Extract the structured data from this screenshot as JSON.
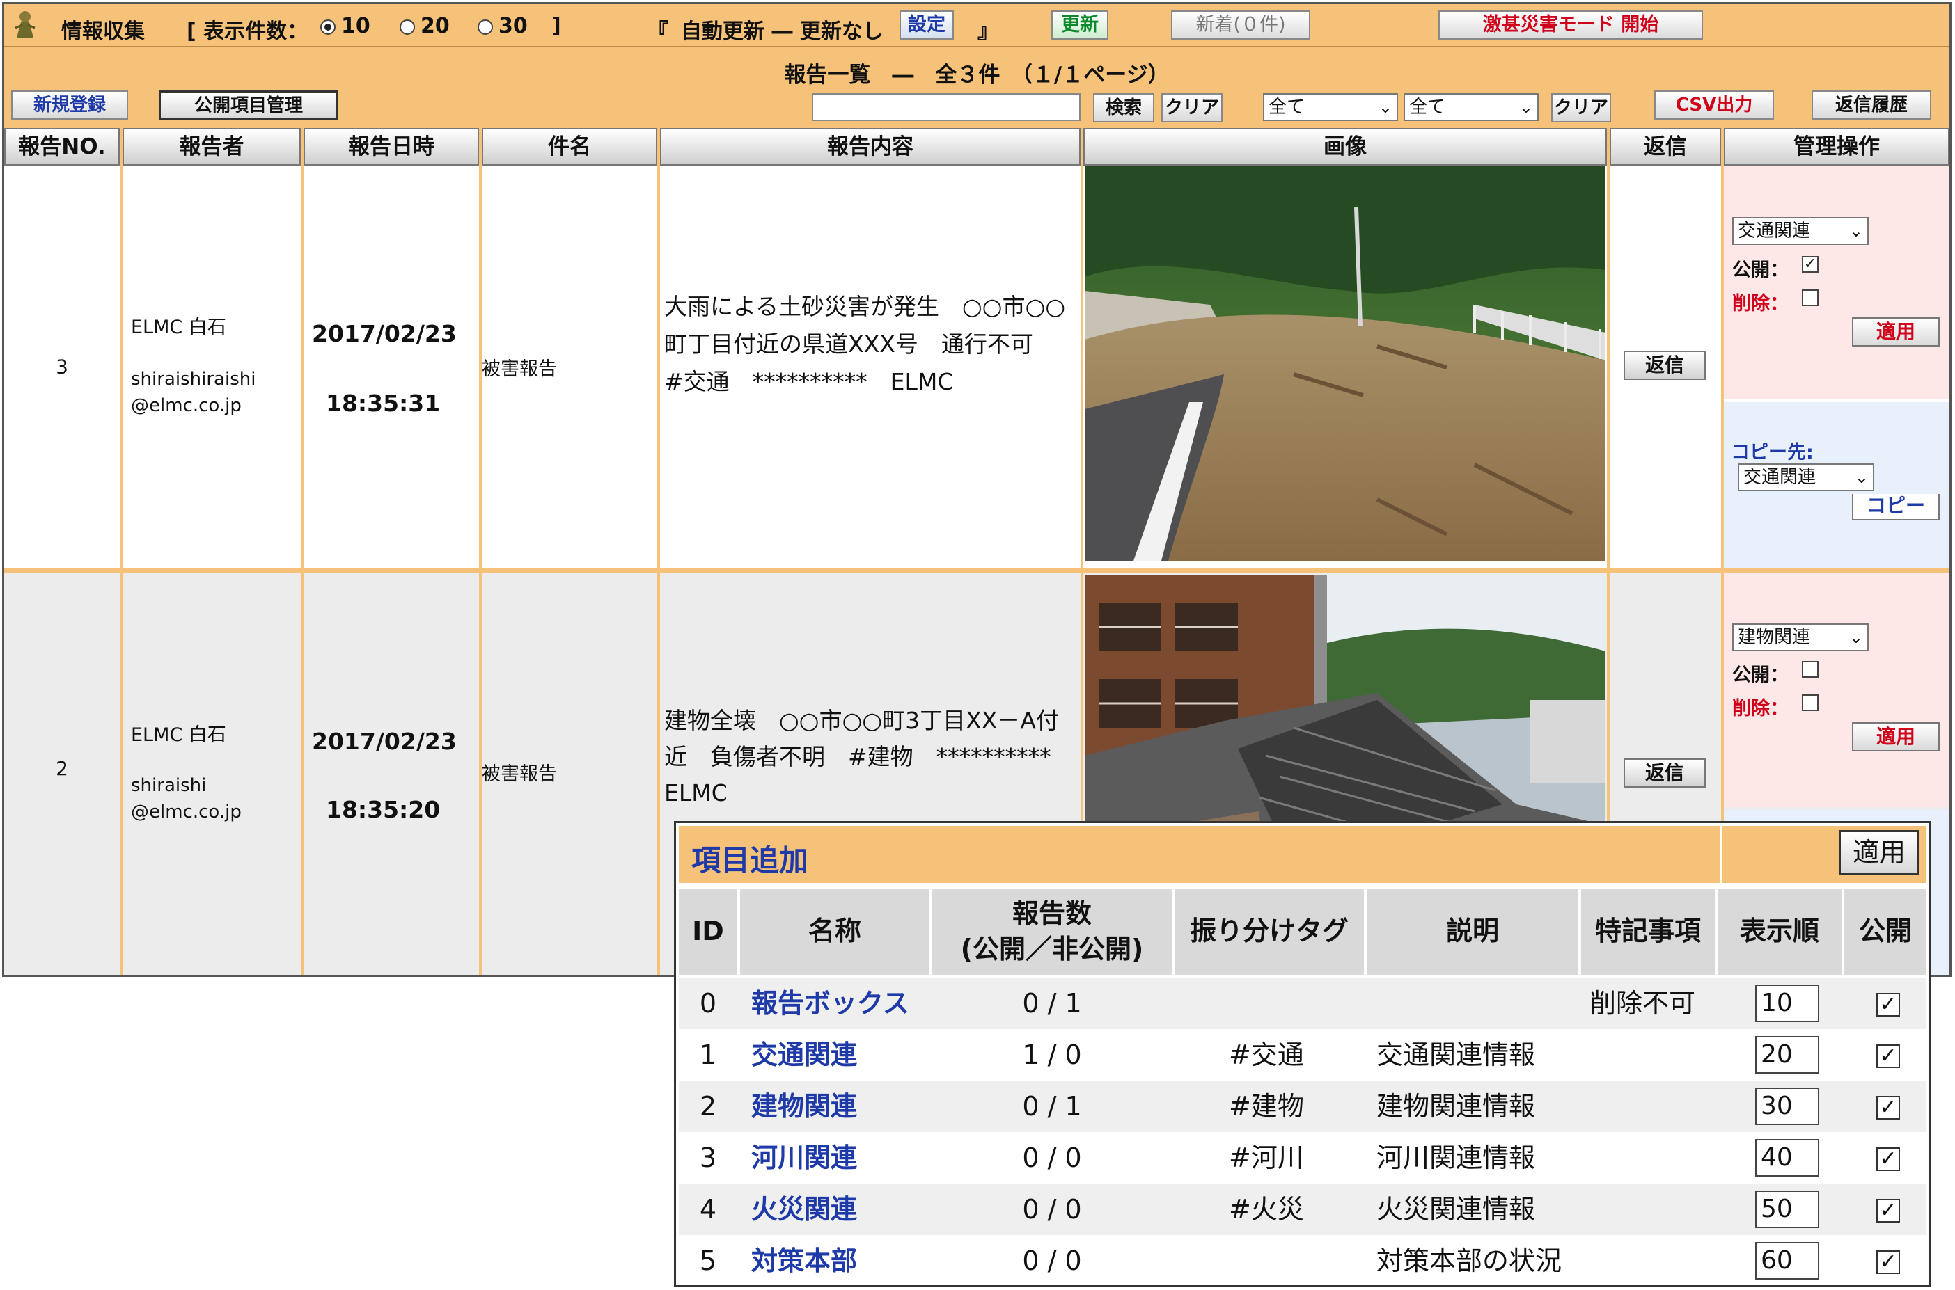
{
  "topbar": {
    "app_title": "情報収集",
    "display_label": "[ 表示件数：",
    "display_options": [
      "10",
      "20",
      "30"
    ],
    "display_selected": "10",
    "display_close": "]",
    "auto_open": "『",
    "auto_update": "自動更新 ― 更新なし",
    "settings_btn": "設定",
    "auto_close": "』",
    "refresh_btn": "更新",
    "new_btn": "新着(０件)",
    "disaster_btn": "激甚災害モード 開始"
  },
  "toolbar": {
    "list_title": "報告一覧　―　全３件　（１/１ページ）",
    "new_register": "新規登録",
    "public_items": "公開項目管理",
    "search_btn": "検索",
    "clear_btn": "クリア",
    "filter1": "全て",
    "filter2": "全て",
    "clear_btn2": "クリア",
    "csv_btn": "CSV出力",
    "reply_history": "返信履歴"
  },
  "table": {
    "headers": [
      "報告NO.",
      "報告者",
      "報告日時",
      "件名",
      "報告内容",
      "画像",
      "返信",
      "管理操作"
    ],
    "rows": [
      {
        "no": "3",
        "reporter_name": "ELMC 白石",
        "reporter_email1": "shiraishiraishi",
        "reporter_email2": "@elmc.co.jp",
        "date": "2017/02/23",
        "time": "18:35:31",
        "subject": "被害報告",
        "content": "大雨による土砂災害が発生　○○市○○町丁目付近の県道XXX号　通行不可　#交通　**********　ELMC",
        "reply": "返信",
        "category": "交通関連",
        "public_label": "公開：",
        "public_checked": true,
        "delete_label": "削除：",
        "apply": "適用",
        "copy_to": "コピー先:",
        "copy_category": "交通関連",
        "copy_btn": "コピー"
      },
      {
        "no": "2",
        "reporter_name": "ELMC 白石",
        "reporter_email1": "shiraishi",
        "reporter_email2": "@elmc.co.jp",
        "date": "2017/02/23",
        "time": "18:35:20",
        "subject": "被害報告",
        "content": "建物全壊　○○市○○町3丁目XX－A付近　負傷者不明　#建物　**********　ELMC",
        "reply": "返信",
        "category": "建物関連",
        "public_label": "公開：",
        "public_checked": false,
        "delete_label": "削除：",
        "apply": "適用"
      }
    ]
  },
  "popup": {
    "title": "項目追加",
    "apply": "適用",
    "headers": {
      "id": "ID",
      "name": "名称",
      "count1": "報告数",
      "count2": "(公開／非公開)",
      "tag": "振り分けタグ",
      "desc": "説明",
      "note": "特記事項",
      "order": "表示順",
      "public": "公開"
    },
    "rows": [
      {
        "id": "0",
        "name": "報告ボックス",
        "count": "0 / 1",
        "tag": "",
        "desc": "",
        "note": "削除不可",
        "order": "10",
        "public": "✓"
      },
      {
        "id": "1",
        "name": "交通関連",
        "count": "1 / 0",
        "tag": "#交通",
        "desc": "交通関連情報",
        "note": "",
        "order": "20",
        "public": "✓"
      },
      {
        "id": "2",
        "name": "建物関連",
        "count": "0 / 1",
        "tag": "#建物",
        "desc": "建物関連情報",
        "note": "",
        "order": "30",
        "public": "✓"
      },
      {
        "id": "3",
        "name": "河川関連",
        "count": "0 / 0",
        "tag": "#河川",
        "desc": "河川関連情報",
        "note": "",
        "order": "40",
        "public": "✓"
      },
      {
        "id": "4",
        "name": "火災関連",
        "count": "0 / 0",
        "tag": "#火災",
        "desc": "火災関連情報",
        "note": "",
        "order": "50",
        "public": "✓"
      },
      {
        "id": "5",
        "name": "対策本部",
        "count": "0 / 0",
        "tag": "",
        "desc": "対策本部の状況",
        "note": "",
        "order": "60",
        "public": "✓"
      }
    ]
  },
  "colors": {
    "header_bg": "#f6c27a",
    "link_blue": "#1e3aa8",
    "alert_red": "#d0021b",
    "row_alt": "#ececec"
  }
}
